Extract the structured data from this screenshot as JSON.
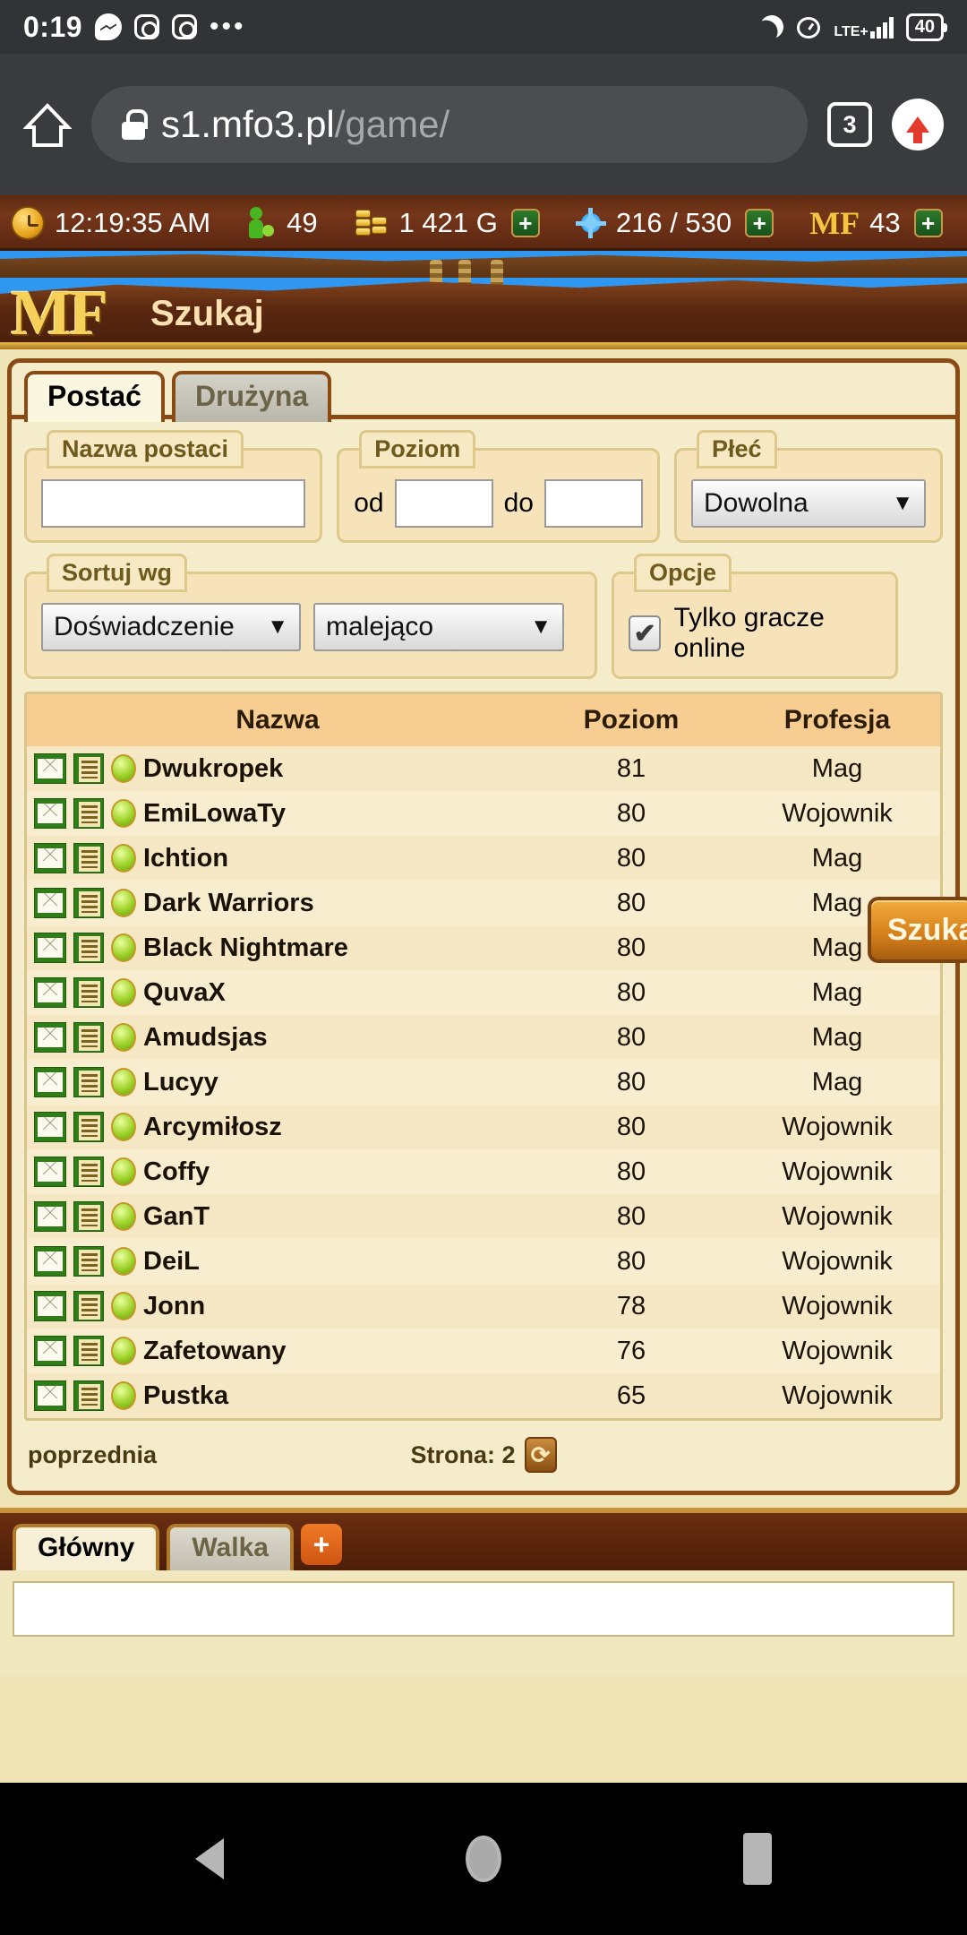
{
  "status_bar": {
    "clock": "0:19",
    "icons_left": [
      "messenger-icon",
      "instagram-icon",
      "instagram-icon",
      "more-dots-icon"
    ],
    "network_label": "LTE+",
    "battery_level": "40",
    "icons_right": [
      "moon-icon",
      "alarm-icon",
      "signal-icon",
      "battery-icon"
    ]
  },
  "browser": {
    "home_icon": "home-icon",
    "lock_icon": "lock-icon",
    "url_host": "s1.mfo3.pl",
    "url_path": "/game/",
    "tab_count": "3",
    "upload_icon": "upload-arrow-icon"
  },
  "resource_bar": {
    "time": "12:19:35 AM",
    "online_players": "49",
    "gold": "1 421 G",
    "energy": "216 / 530",
    "mf_label": "MF",
    "mf_value": "43",
    "plus": "+"
  },
  "banner": {
    "logo": "MF",
    "title": "Szukaj"
  },
  "tabs": [
    {
      "label": "Postać",
      "active": true
    },
    {
      "label": "Drużyna",
      "active": false
    }
  ],
  "filters": {
    "name": {
      "legend": "Nazwa postaci",
      "value": "",
      "placeholder": ""
    },
    "level": {
      "legend": "Poziom",
      "from_label": "od",
      "from_value": "",
      "to_label": "do",
      "to_value": ""
    },
    "gender": {
      "legend": "Płeć",
      "value": "Dowolna"
    },
    "sort": {
      "legend": "Sortuj wg",
      "by_value": "Doświadczenie",
      "dir_value": "malejąco"
    },
    "options": {
      "legend": "Opcje",
      "checkbox_label": "Tylko gracze online",
      "checked": true
    },
    "search_button": "Szukaj"
  },
  "table": {
    "headers": {
      "name": "Nazwa",
      "level": "Poziom",
      "profession": "Profesja"
    },
    "rows": [
      {
        "name": "Dwukropek",
        "level": "81",
        "profession": "Mag"
      },
      {
        "name": "EmiLowaTy",
        "level": "80",
        "profession": "Wojownik"
      },
      {
        "name": "Ichtion",
        "level": "80",
        "profession": "Mag"
      },
      {
        "name": "Dark Warriors",
        "level": "80",
        "profession": "Mag"
      },
      {
        "name": "Black Nightmare",
        "level": "80",
        "profession": "Mag"
      },
      {
        "name": "QuvaX",
        "level": "80",
        "profession": "Mag"
      },
      {
        "name": "Amudsjas",
        "level": "80",
        "profession": "Mag"
      },
      {
        "name": "Lucyy",
        "level": "80",
        "profession": "Mag"
      },
      {
        "name": "Arcymiłosz",
        "level": "80",
        "profession": "Wojownik"
      },
      {
        "name": "Coffy",
        "level": "80",
        "profession": "Wojownik"
      },
      {
        "name": "GanT",
        "level": "80",
        "profession": "Wojownik"
      },
      {
        "name": "DeiL",
        "level": "80",
        "profession": "Wojownik"
      },
      {
        "name": "Jonn",
        "level": "78",
        "profession": "Wojownik"
      },
      {
        "name": "Zafetowany",
        "level": "76",
        "profession": "Wojownik"
      },
      {
        "name": "Pustka",
        "level": "65",
        "profession": "Wojownik"
      }
    ]
  },
  "pager": {
    "previous": "poprzednia",
    "page_label": "Strona: 2",
    "refresh_icon": "refresh-icon"
  },
  "chat": {
    "tabs": [
      {
        "label": "Główny",
        "active": true
      },
      {
        "label": "Walka",
        "active": false
      }
    ],
    "add_tab": "+",
    "input_value": ""
  },
  "nav_bar": {
    "back": "back-icon",
    "home": "home-icon",
    "recents": "recents-icon"
  }
}
